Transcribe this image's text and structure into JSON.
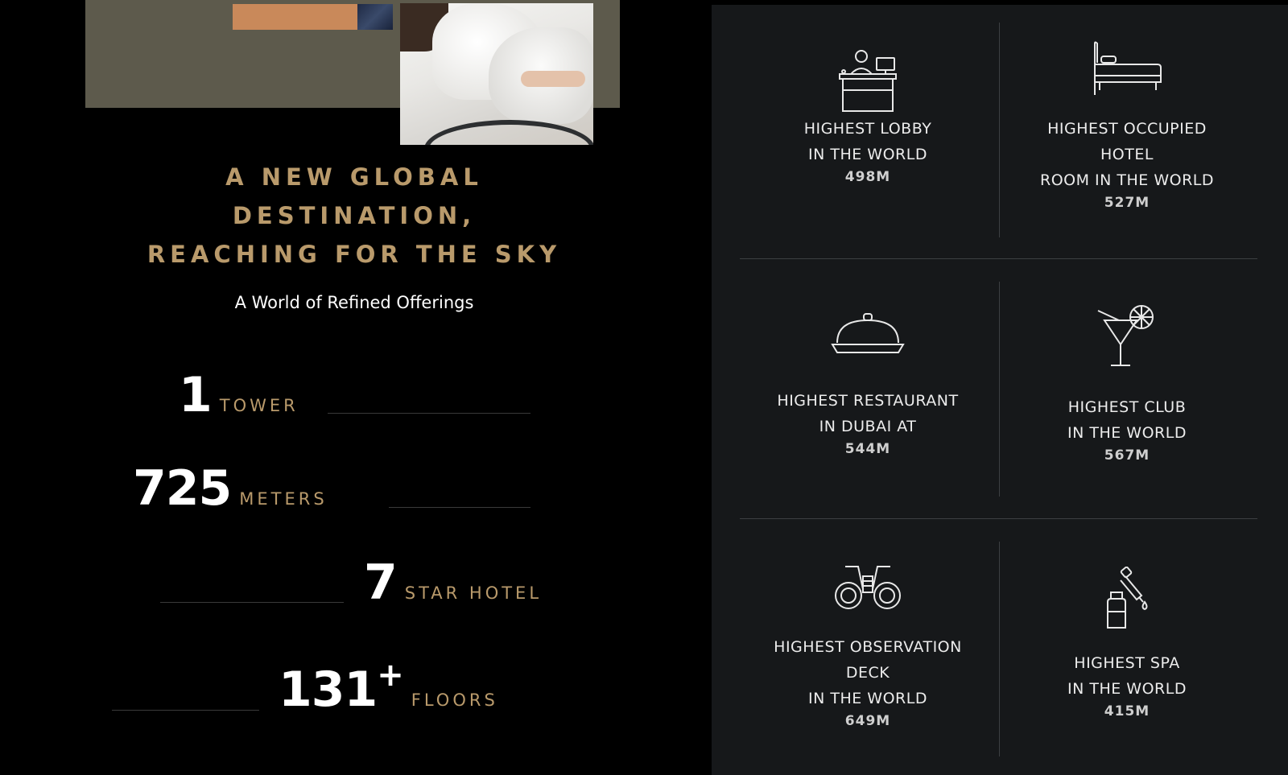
{
  "headline": {
    "line1": "A NEW GLOBAL",
    "line2": "DESTINATION,",
    "line3": "REACHING FOR THE SKY"
  },
  "subheadline": "A World of Refined Offerings",
  "stats": [
    {
      "number": "1",
      "unit": "TOWER"
    },
    {
      "number": "725",
      "unit": "METERS"
    },
    {
      "number": "7",
      "unit": "STAR HOTEL"
    },
    {
      "number": "131",
      "suffix": "+",
      "unit": "FLOORS"
    }
  ],
  "features": [
    {
      "icon": "reception-desk-icon",
      "title": [
        "HIGHEST LOBBY",
        "IN THE WORLD"
      ],
      "value": "498M"
    },
    {
      "icon": "bed-icon",
      "title": [
        "HIGHEST OCCUPIED",
        "HOTEL",
        "ROOM IN THE WORLD"
      ],
      "value": "527M"
    },
    {
      "icon": "cloche-icon",
      "title": [
        "HIGHEST RESTAURANT",
        "IN DUBAI AT"
      ],
      "value": "544M"
    },
    {
      "icon": "cocktail-icon",
      "title": [
        "HIGHEST CLUB",
        "IN THE WORLD"
      ],
      "value": "567M"
    },
    {
      "icon": "binoculars-icon",
      "title": [
        "HIGHEST OBSERVATION",
        "DECK",
        "IN THE WORLD"
      ],
      "value": "649M"
    },
    {
      "icon": "dropper-bottle-icon",
      "title": [
        "HIGHEST SPA",
        "IN THE WORLD"
      ],
      "value": "415M"
    }
  ],
  "colors": {
    "gold": "#b99a6b",
    "panel": "#16181a",
    "background": "#000000"
  }
}
